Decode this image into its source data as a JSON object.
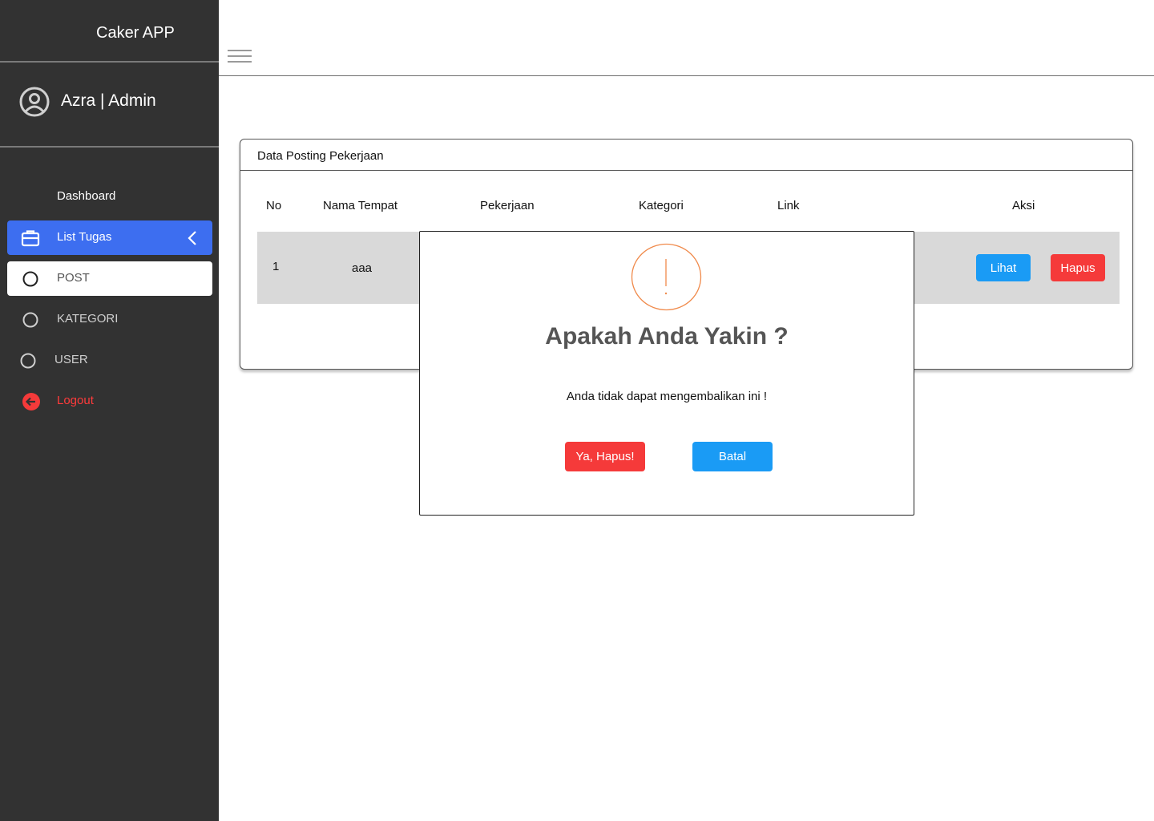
{
  "app": {
    "title": "Caker APP"
  },
  "profile": {
    "name": "Azra | Admin",
    "icon": "user-circle-icon"
  },
  "sidebar": {
    "items": [
      {
        "label": "Dashboard"
      },
      {
        "label": "List Tugas",
        "icon": "briefcase-icon",
        "active": true
      },
      {
        "label": "POST",
        "icon": "circle-icon",
        "selected": true
      },
      {
        "label": "KATEGORI",
        "icon": "circle-icon"
      },
      {
        "label": "USER",
        "icon": "circle-icon"
      },
      {
        "label": "Logout",
        "icon": "arrow-left-circle-icon",
        "color": "#ff3b3b"
      }
    ],
    "accent": "#3d6ef0"
  },
  "card": {
    "title": "Data Posting Pekerjaan",
    "columns": [
      "No",
      "Nama Tempat",
      "Pekerjaan",
      "Kategori",
      "Link",
      "Aksi"
    ],
    "rows": [
      {
        "no": "1",
        "nama_tempat": "aaa",
        "actions": [
          "Lihat",
          "Hapus"
        ]
      }
    ]
  },
  "modal": {
    "icon": "warning-icon",
    "title": "Apakah Anda Yakin ?",
    "message": "Anda tidak dapat mengembalikan ini  !",
    "confirm_label": "Ya, Hapus!",
    "cancel_label": "Batal"
  },
  "colors": {
    "danger": "#f53a3a",
    "info": "#1a9bf5",
    "warning": "#f08a4b"
  }
}
